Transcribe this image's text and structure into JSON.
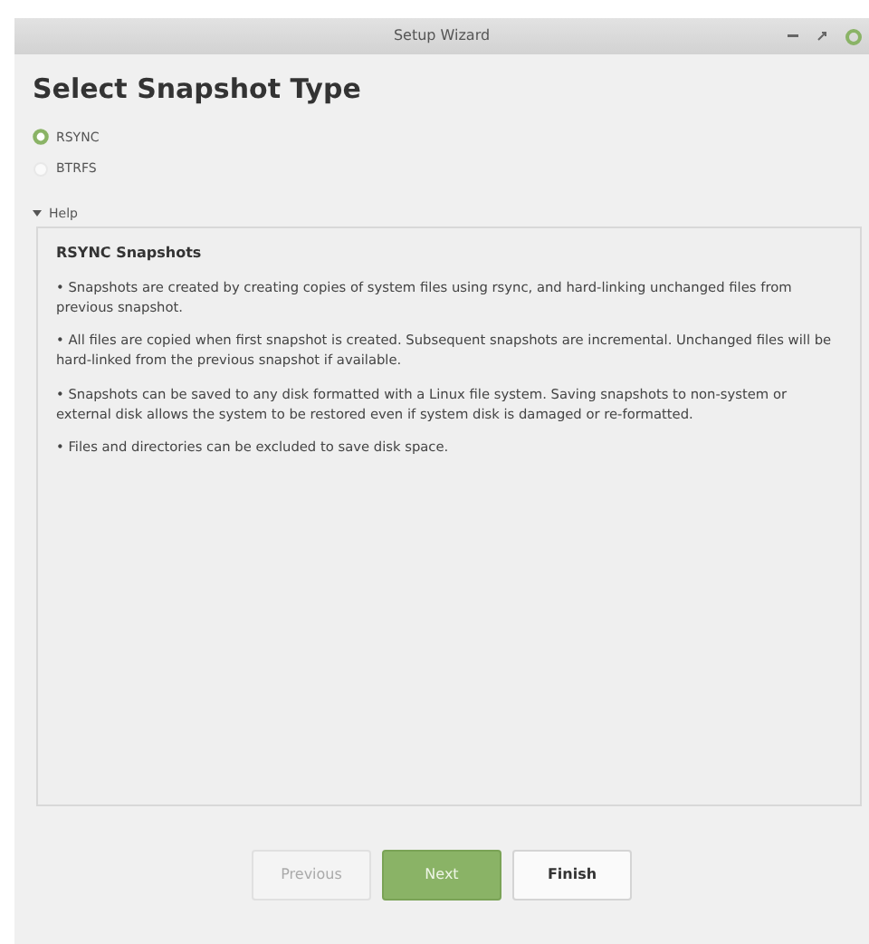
{
  "window": {
    "title": "Setup Wizard"
  },
  "heading": "Select Snapshot Type",
  "options": [
    {
      "label": "RSYNC",
      "selected": true
    },
    {
      "label": "BTRFS",
      "selected": false
    }
  ],
  "help": {
    "label": "Help",
    "expanded": true,
    "title": "RSYNC Snapshots",
    "paragraphs": [
      "• Snapshots are created by creating copies of system files using rsync, and hard-linking unchanged files from previous snapshot.",
      "• All files are copied when first snapshot is created. Subsequent snapshots are incremental. Unchanged files will be hard-linked from the previous snapshot if available.",
      "• Snapshots can be saved to any disk formatted with a Linux file system. Saving snapshots to non-system or external disk allows the system to be restored even if system disk is damaged or re-formatted.",
      "• Files and directories can be excluded to save disk space."
    ]
  },
  "buttons": [
    {
      "label": "Previous",
      "kind": "default",
      "disabled": true
    },
    {
      "label": "Next",
      "kind": "primary",
      "disabled": false
    },
    {
      "label": "Finish",
      "kind": "default",
      "disabled": false
    }
  ]
}
